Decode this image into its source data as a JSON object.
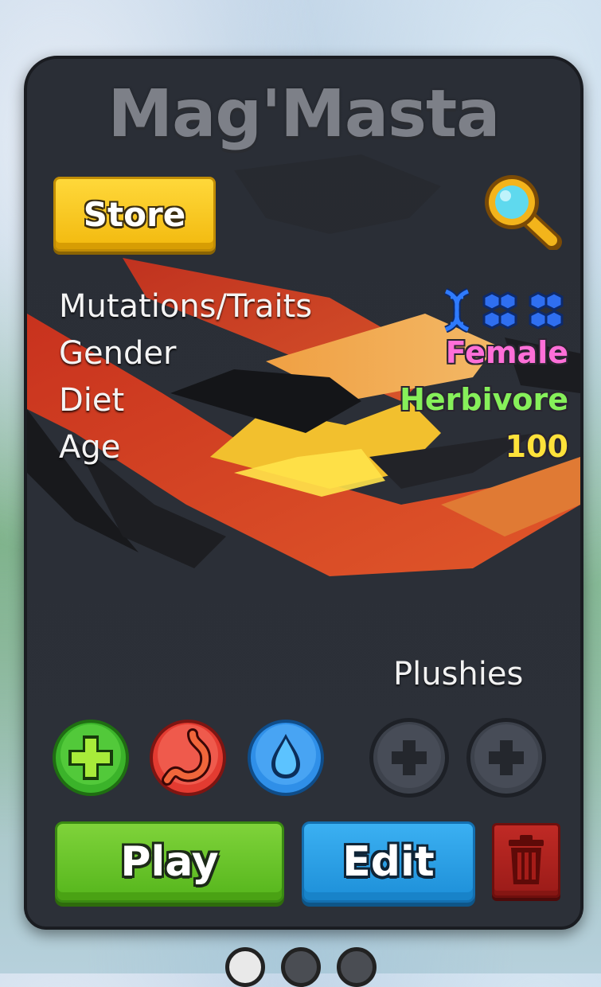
{
  "card": {
    "title": "Mag'Masta",
    "store_label": "Store",
    "stats": [
      {
        "label": "Mutations/Traits",
        "value": "",
        "color": "#2f7bff"
      },
      {
        "label": "Gender",
        "value": "Female",
        "color": "#ff6fd8"
      },
      {
        "label": "Diet",
        "value": "Herbivore",
        "color": "#86f05a"
      },
      {
        "label": "Age",
        "value": "100",
        "color": "#ffe23a"
      }
    ],
    "mutation_icons": [
      "dna-icon",
      "hex-cluster-icon",
      "hex-cluster-icon"
    ],
    "plushies_label": "Plushies",
    "care_buttons": [
      {
        "icon": "health-plus-icon",
        "color": "#3bb32a"
      },
      {
        "icon": "stomach-icon",
        "color": "#e33b31"
      },
      {
        "icon": "water-drop-icon",
        "color": "#2f8fe8"
      }
    ],
    "plushie_slots": [
      "add-plushie-icon",
      "add-plushie-icon"
    ],
    "play_label": "Play",
    "edit_label": "Edit"
  },
  "pager": {
    "pages": 3,
    "active": 1
  }
}
